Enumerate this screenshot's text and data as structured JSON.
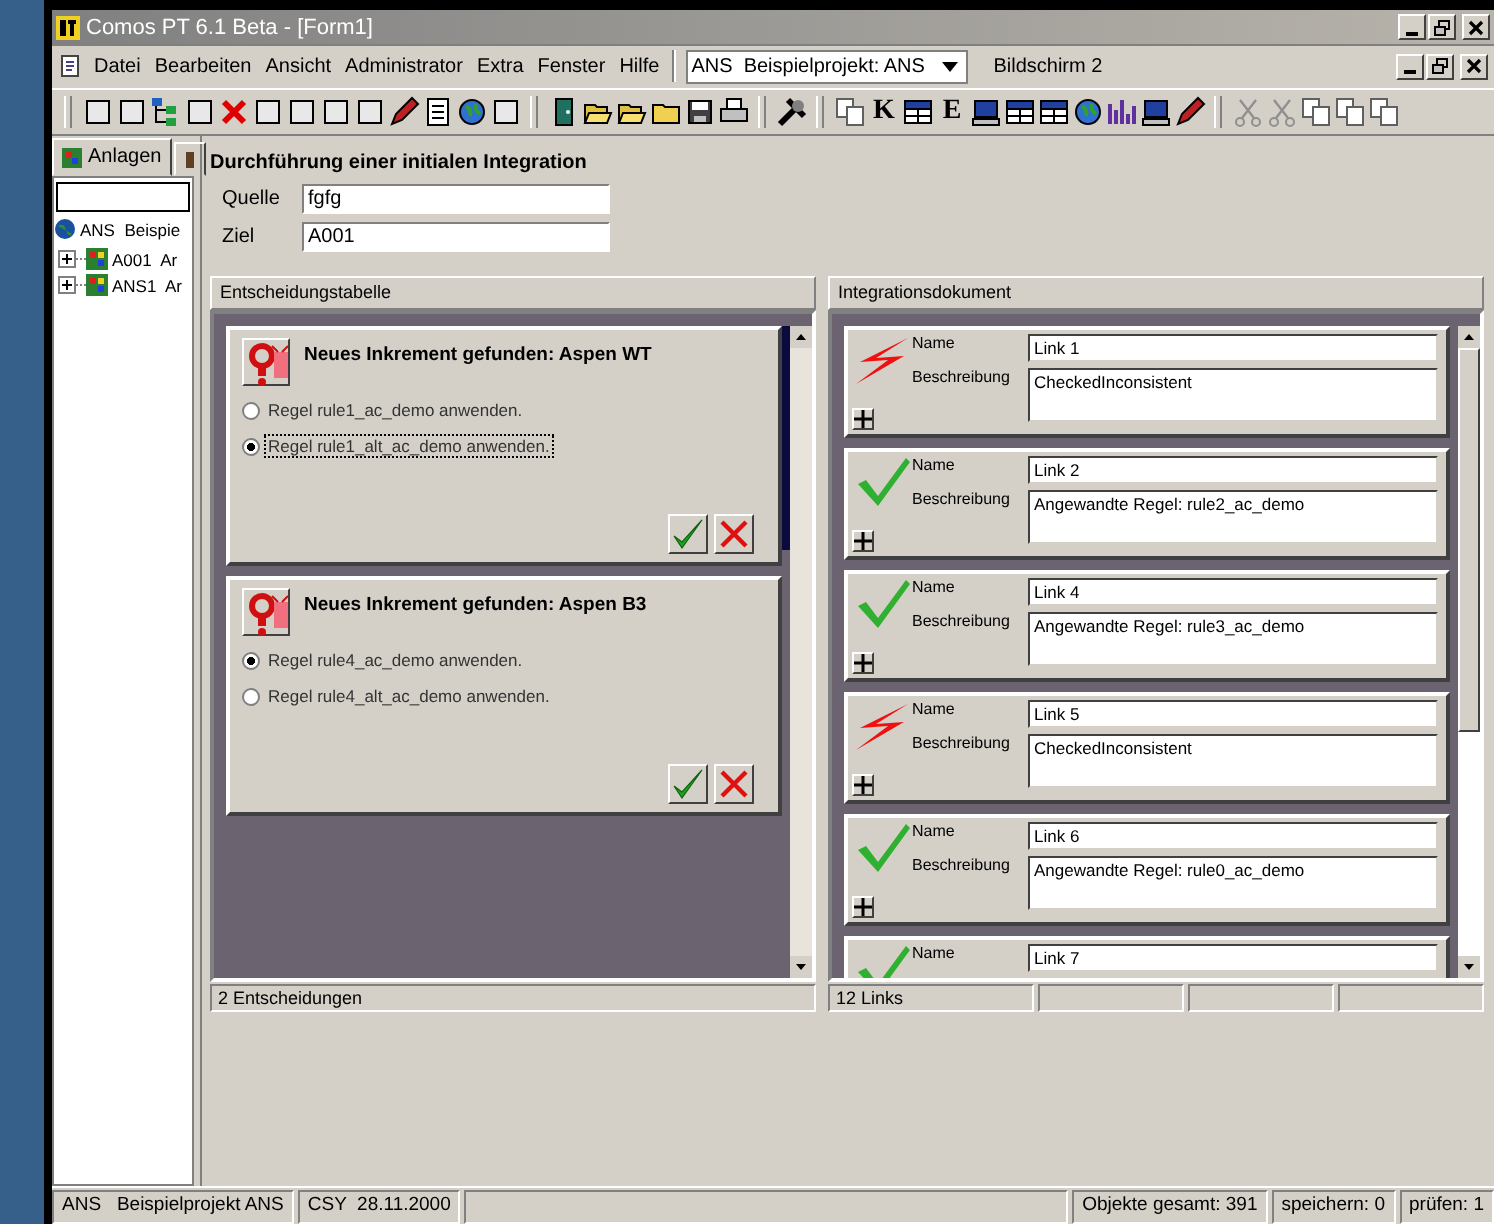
{
  "window": {
    "title": "Comos PT 6.1 Beta - [Form1]"
  },
  "menu": [
    "Datei",
    "Bearbeiten",
    "Ansicht",
    "Administrator",
    "Extra",
    "Fenster",
    "Hilfe"
  ],
  "project_select": {
    "value": "ANS  Beispielprojekt: ANS"
  },
  "screen_label": "Bildschirm 2",
  "toolbar": [
    [
      {
        "kind": "blank"
      },
      {
        "kind": "blank"
      },
      {
        "kind": "tree"
      },
      {
        "kind": "blank"
      },
      {
        "kind": "delete"
      },
      {
        "kind": "blank"
      },
      {
        "kind": "blank"
      },
      {
        "kind": "blank"
      },
      {
        "kind": "blank"
      },
      {
        "kind": "pen"
      },
      {
        "kind": "doc"
      },
      {
        "kind": "globe"
      },
      {
        "kind": "blank"
      }
    ],
    [
      {
        "kind": "exit"
      },
      {
        "kind": "open"
      },
      {
        "kind": "open"
      },
      {
        "kind": "folder"
      },
      {
        "kind": "save"
      },
      {
        "kind": "print"
      }
    ],
    [
      {
        "kind": "tools"
      }
    ],
    [
      {
        "kind": "copy"
      },
      {
        "kind": "glyph",
        "text": "K"
      },
      {
        "kind": "grid"
      },
      {
        "kind": "glyph",
        "text": "E"
      },
      {
        "kind": "monitor"
      },
      {
        "kind": "grid"
      },
      {
        "kind": "grid"
      },
      {
        "kind": "globe"
      },
      {
        "kind": "chart"
      },
      {
        "kind": "monitor"
      },
      {
        "kind": "pen"
      }
    ],
    [
      {
        "kind": "cut"
      },
      {
        "kind": "cut"
      },
      {
        "kind": "copy"
      },
      {
        "kind": "copy"
      },
      {
        "kind": "copy"
      }
    ]
  ],
  "left_pane": {
    "tabs": [
      {
        "label": "Anlagen",
        "selected": true
      }
    ],
    "tree": [
      {
        "label": "ANS  Beispie",
        "kind": "project",
        "children": [
          {
            "label": "A001  Ar",
            "kind": "plant",
            "expanded": false
          },
          {
            "label": "ANS1  Ar",
            "kind": "plant",
            "expanded": false
          }
        ]
      }
    ]
  },
  "form": {
    "title": "Durchführung einer initialen Integration",
    "fields": [
      {
        "label": "Quelle",
        "value": "fgfg"
      },
      {
        "label": "Ziel",
        "value": "A001"
      }
    ],
    "decisions": {
      "title": "Entscheidungstabelle",
      "status": "2 Entscheidungen",
      "cards": [
        {
          "heading": "Neues Inkrement gefunden: Aspen WT",
          "selected": true,
          "options": [
            {
              "label": "Regel rule1_ac_demo anwenden.",
              "selected": false,
              "focused": false
            },
            {
              "label": "Regel rule1_alt_ac_demo anwenden.",
              "selected": true,
              "focused": true
            }
          ]
        },
        {
          "heading": "Neues Inkrement gefunden: Aspen B3",
          "selected": false,
          "options": [
            {
              "label": "Regel rule4_ac_demo anwenden.",
              "selected": true,
              "focused": false
            },
            {
              "label": "Regel rule4_alt_ac_demo anwenden.",
              "selected": false,
              "focused": false
            }
          ]
        }
      ]
    },
    "links": {
      "title": "Integrationsdokument",
      "status": "12 Links",
      "items": [
        {
          "kind": "inconsistent",
          "name_label": "Name",
          "name": "Link 1",
          "description_label": "Beschreibung",
          "description": "CheckedInconsistent"
        },
        {
          "kind": "applied",
          "name_label": "Name",
          "name": "Link 2",
          "description_label": "Beschreibung",
          "description": "Angewandte Regel: rule2_ac_demo"
        },
        {
          "kind": "applied",
          "name_label": "Name",
          "name": "Link 4",
          "description_label": "Beschreibung",
          "description": "Angewandte Regel: rule3_ac_demo"
        },
        {
          "kind": "inconsistent",
          "name_label": "Name",
          "name": "Link 5",
          "description_label": "Beschreibung",
          "description": "CheckedInconsistent"
        },
        {
          "kind": "applied",
          "name_label": "Name",
          "name": "Link 6",
          "description_label": "Beschreibung",
          "description": "Angewandte Regel: rule0_ac_demo"
        },
        {
          "kind": "applied",
          "name_label": "Name",
          "name": "Link 7"
        }
      ]
    }
  },
  "status_bar": [
    "ANS   Beispielprojekt ANS",
    "CSY  28.11.2000",
    "Objekte gesamt: 391",
    "speichern: 0",
    "prüfen: 1"
  ]
}
